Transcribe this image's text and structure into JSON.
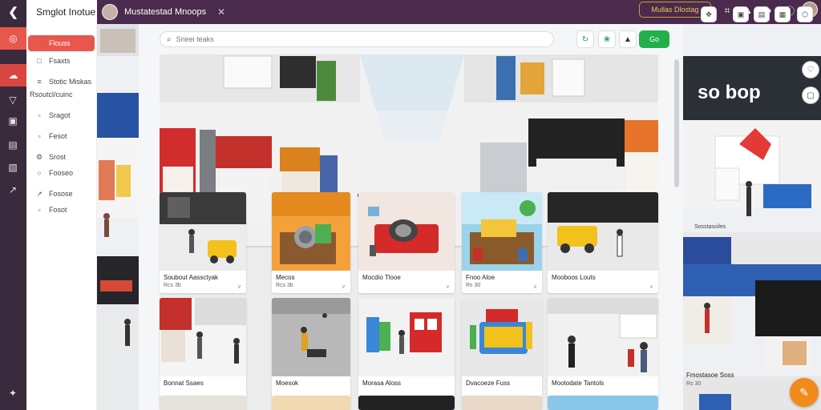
{
  "app": {
    "brand": "Smglot Inotue"
  },
  "window_tab": {
    "title": "Mustatestad Mnoops"
  },
  "promo": {
    "label": "Mullas Dlostag"
  },
  "sidebar": {
    "items": [
      {
        "label": "Flouss",
        "icon": "store-icon"
      },
      {
        "label": "Fsaxts",
        "icon": "tag-icon"
      },
      {
        "label": "Stotic Miskas",
        "icon": "list-icon"
      },
      {
        "label": "Rsoutcl/cuinc",
        "icon": ""
      },
      {
        "label": "Sragot",
        "icon": "doc-icon"
      },
      {
        "label": "Fesot",
        "icon": "doc-icon"
      },
      {
        "label": "Srost",
        "icon": "gear-icon"
      },
      {
        "label": "Fooseo",
        "icon": "circle-icon"
      },
      {
        "label": "Fosose",
        "icon": "share-icon"
      },
      {
        "label": "Fosot",
        "icon": "doc-icon"
      }
    ]
  },
  "search": {
    "placeholder": "Srieei teaks"
  },
  "actions": {
    "go_label": "Go"
  },
  "cards": [
    {
      "title": "Soubout Aassctyak",
      "price": "Rcs 3b"
    },
    {
      "title": "Mecos",
      "price": "Rcs 3b"
    },
    {
      "title": "Mocdio Tlooe",
      "price": ""
    },
    {
      "title": "Fnoo Aloe",
      "price": "Rs 30"
    },
    {
      "title": "Mooboos Louts",
      "price": ""
    },
    {
      "title": "Bonnat Ssaes",
      "price": ""
    },
    {
      "title": "Moesok",
      "price": ""
    },
    {
      "title": "Morasa Aloss",
      "price": ""
    },
    {
      "title": "Dvacoeze Fuss",
      "price": ""
    },
    {
      "title": "Mootodate Tantols",
      "price": ""
    }
  ],
  "right_strip": {
    "sign": "so bop",
    "caption_top": "Sosstasoiles",
    "caption_bottom": "Fmostasoe Soss",
    "caption_bottom_sub": "Rs 30"
  },
  "colors": {
    "rail": "#3a2a3e",
    "accent": "#e8574c",
    "window_bar": "#4a2a4d",
    "primary_button": "#22b04b",
    "fab": "#f28a1c"
  }
}
